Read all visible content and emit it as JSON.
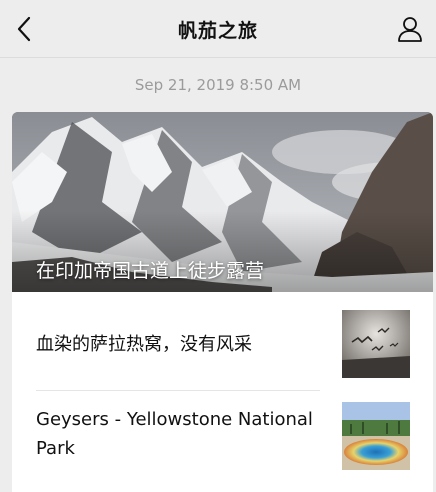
{
  "nav": {
    "title": "帆茄之旅",
    "back_icon": "chevron-left-icon",
    "profile_icon": "person-icon"
  },
  "timestamp": "Sep 21, 2019 8:50 AM",
  "card": {
    "hero_title": "在印加帝国古道上徒步露营",
    "items": [
      {
        "title": "血染的萨拉热窝，没有风采"
      },
      {
        "title": "Geysers - Yellowstone National Park"
      }
    ]
  }
}
